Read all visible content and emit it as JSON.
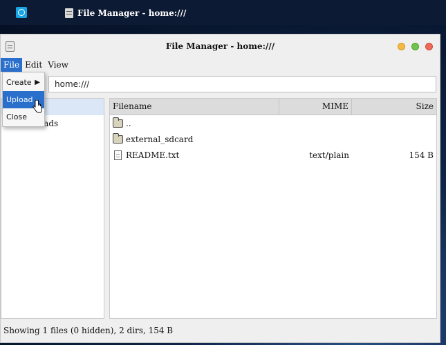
{
  "taskbar": {
    "task_title": "File Manager - home:///"
  },
  "window": {
    "title": "File Manager - home:///"
  },
  "menubar": {
    "items": [
      "File",
      "Edit",
      "View"
    ]
  },
  "file_menu": {
    "create_label": "Create",
    "upload_label": "Upload",
    "close_label": "Close"
  },
  "address": {
    "value": "home:///"
  },
  "tree": {
    "items": [
      "",
      "Downloads"
    ],
    "visible_partial": "oads"
  },
  "file_table": {
    "headers": {
      "filename": "Filename",
      "mime": "MIME",
      "size": "Size"
    },
    "rows": [
      {
        "name": "..",
        "type": "folder",
        "mime": "",
        "size": ""
      },
      {
        "name": "external_sdcard",
        "type": "folder",
        "mime": "",
        "size": ""
      },
      {
        "name": "README.txt",
        "type": "file",
        "mime": "text/plain",
        "size": "154 B"
      }
    ]
  },
  "status": {
    "text": "Showing 1 files (0 hidden), 2 dirs, 154 B"
  },
  "colors": {
    "accent": "#2a6fcb",
    "selection": "#dbe7f7",
    "folder": "#d8d3bd"
  }
}
